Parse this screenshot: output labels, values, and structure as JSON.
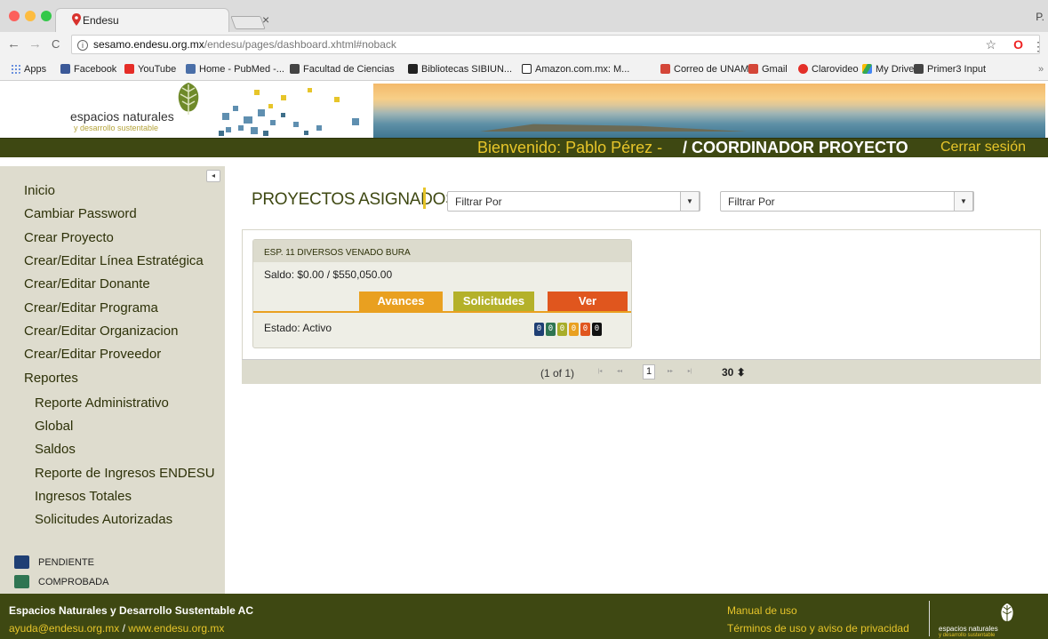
{
  "browser": {
    "tab_title": "Endesu",
    "tab_close": "×",
    "profile_initial": "P.",
    "url_host": "sesamo.endesu.org.mx",
    "url_path": "/endesu/pages/dashboard.xhtml#noback",
    "nav_back": "←",
    "nav_forward": "→",
    "nav_reload": "C",
    "star": "☆",
    "menu": "⋮",
    "bookmarks": [
      {
        "label": "Apps",
        "color": "#3b6ed6"
      },
      {
        "label": "Facebook",
        "color": "#3b5998"
      },
      {
        "label": "YouTube",
        "color": "#e52d27"
      },
      {
        "label": "Home - PubMed -...",
        "color": "#4a6fa8"
      },
      {
        "label": "Facultad de Ciencias",
        "color": "#444444"
      },
      {
        "label": "Bibliotecas SIBIUN...",
        "color": "#222222"
      },
      {
        "label": "Amazon.com.mx: M...",
        "color": "#222222"
      },
      {
        "label": "Correo de UNAM",
        "color": "#d44638"
      },
      {
        "label": "Gmail",
        "color": "#d44638"
      },
      {
        "label": "Clarovideo",
        "color": "#e32f28"
      },
      {
        "label": "My Drive",
        "color": "#34a853"
      },
      {
        "label": "Primer3 Input",
        "color": "#444444"
      }
    ],
    "bookmarks_more": "»"
  },
  "header": {
    "logo_line1": "espacios naturales",
    "logo_line2": "y desarrollo sustentable",
    "welcome_name": "Bienvenido: Pablo Pérez -",
    "welcome_role": "/ COORDINADOR PROYECTO",
    "logout": "Cerrar sesión"
  },
  "sidebar": {
    "collapse": "◂",
    "items": [
      "Inicio",
      "Cambiar Password",
      "Crear Proyecto",
      "Crear/Editar Línea Estratégica",
      "Crear/Editar Donante",
      "Crear/Editar Programa",
      "Crear/Editar Organizacion",
      "Crear/Editar Proveedor",
      "Reportes"
    ],
    "sub_items": [
      "Reporte Administrativo",
      "Global",
      "Saldos",
      "Reporte de Ingresos ENDESU",
      "Ingresos Totales",
      "Solicitudes Autorizadas"
    ],
    "legend": [
      {
        "label": "PENDIENTE",
        "color": "#1f3f74"
      },
      {
        "label": "COMPROBADA",
        "color": "#2f7552"
      }
    ]
  },
  "main": {
    "title": "PROYECTOS ASIGNADOS",
    "filter1": "Filtrar Por",
    "filter2": "Filtrar Por",
    "filter_arrow": "▼",
    "card": {
      "name": "ESP. 11 DIVERSOS VENADO BURA",
      "saldo": "Saldo: $0.00 / $550,050.00",
      "btn_avances": "Avances",
      "btn_solicitudes": "Solicitudes",
      "btn_ver": "Ver",
      "estado": "Estado: Activo",
      "counters": [
        {
          "value": "0",
          "color": "#1f3f74"
        },
        {
          "value": "0",
          "color": "#2f7552"
        },
        {
          "value": "0",
          "color": "#a7ad2a"
        },
        {
          "value": "0",
          "color": "#e9a020"
        },
        {
          "value": "0",
          "color": "#e0561e"
        },
        {
          "value": "0",
          "color": "#111111"
        }
      ]
    },
    "pager": {
      "info": "(1 of 1)",
      "first": "|◂",
      "prev": "◂◂",
      "page": "1",
      "next": "▸▸",
      "last": "▸|",
      "size": "30 ⬍"
    }
  },
  "footer": {
    "org": "Espacios Naturales y Desarrollo Sustentable AC",
    "email": "ayuda@endesu.org.mx",
    "sep": "/",
    "site": "www.endesu.org.mx",
    "manual": "Manual de uso",
    "terms": "Términos de uso y aviso de privacidad",
    "logo_line1": "espacios naturales",
    "logo_line2": "y desarrollo sustentable"
  },
  "colors": {
    "brand_dark": "#3e4812",
    "brand_yellow": "#e7c52a",
    "btn_avances": "#e9a020",
    "btn_solicitudes": "#b4b12a",
    "btn_ver": "#e0561e"
  }
}
